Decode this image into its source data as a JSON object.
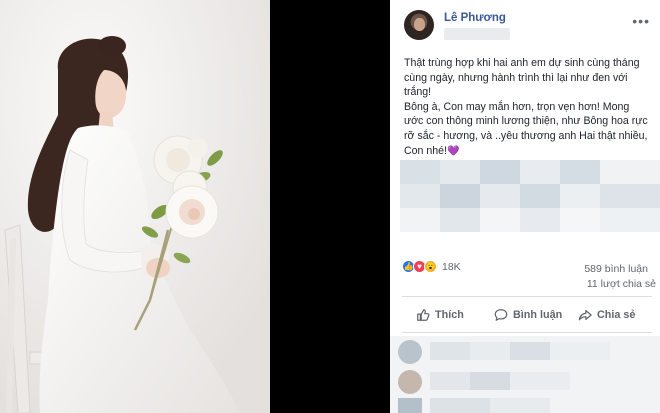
{
  "post": {
    "author": "Lê Phương",
    "more_icon": "more-dots-icon",
    "text_lines": [
      "Thật trùng hợp khi hai anh em dự sinh cùng tháng cùng ngày, nhưng hành trình thì lại như đen với trắng!",
      "Bông à, Con may mắn hơn, trọn vẹn hơn! Mong ước con thông minh lương thiện, như Bông hoa rực rỡ sắc - hương, và ..yêu thương anh Hai thật nhiều, Con nhé!"
    ],
    "emoji": "💜",
    "reactions": {
      "count": "18K",
      "icons": [
        "like-reaction-icon",
        "love-reaction-icon",
        "wow-reaction-icon"
      ]
    },
    "comment_count": "589 bình luận",
    "share_count": "11 lượt chia sẻ",
    "actions": {
      "like": "Thích",
      "comment": "Bình luận",
      "share": "Chia sẻ"
    }
  },
  "colors": {
    "link_blue": "#385898",
    "muted_text": "#606770",
    "like_blue": "#2078f4",
    "love_red": "#f33e58",
    "wow_yellow": "#f7b125",
    "heart_purple": "#8a3fd9"
  }
}
